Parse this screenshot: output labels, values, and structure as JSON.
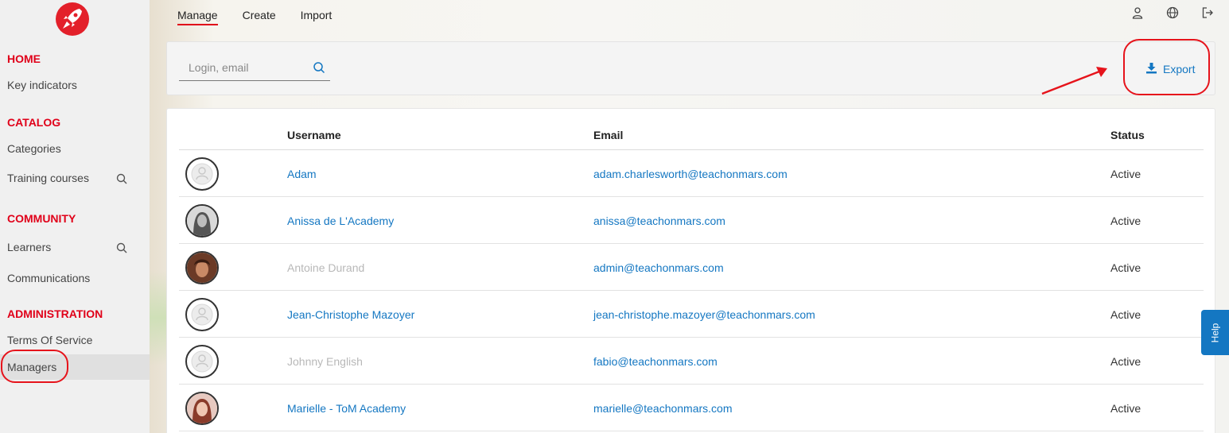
{
  "sidebar": {
    "sections": [
      {
        "title": "HOME",
        "items": [
          {
            "label": "Key indicators"
          }
        ]
      },
      {
        "title": "CATALOG",
        "items": [
          {
            "label": "Categories"
          },
          {
            "label": "Training courses"
          }
        ]
      },
      {
        "title": "COMMUNITY",
        "items": [
          {
            "label": "Learners"
          },
          {
            "label": "Communications"
          }
        ]
      },
      {
        "title": "ADMINISTRATION",
        "items": [
          {
            "label": "Terms Of Service"
          },
          {
            "label": "Managers"
          }
        ]
      }
    ]
  },
  "topnav": {
    "tabs": [
      "Manage",
      "Create",
      "Import"
    ],
    "active": "Manage"
  },
  "toolbar": {
    "search_placeholder": "Login, email",
    "export_label": "Export"
  },
  "table": {
    "columns": {
      "username": "Username",
      "email": "Email",
      "status": "Status"
    },
    "rows": [
      {
        "username": "Adam",
        "email": "adam.charlesworth@teachonmars.com",
        "status": "Active",
        "avatar": "default-avatar-icon",
        "dimmed": false
      },
      {
        "username": "Anissa de L'Academy",
        "email": "anissa@teachonmars.com",
        "status": "Active",
        "avatar": "photo",
        "dimmed": false
      },
      {
        "username": "Antoine Durand",
        "email": "admin@teachonmars.com",
        "status": "Active",
        "avatar": "photo",
        "dimmed": true
      },
      {
        "username": "Jean-Christophe Mazoyer",
        "email": "jean-christophe.mazoyer@teachonmars.com",
        "status": "Active",
        "avatar": "default-avatar-icon",
        "dimmed": false
      },
      {
        "username": "Johnny English",
        "email": "fabio@teachonmars.com",
        "status": "Active",
        "avatar": "default-avatar-icon",
        "dimmed": true
      },
      {
        "username": "Marielle - ToM Academy",
        "email": "marielle@teachonmars.com",
        "status": "Active",
        "avatar": "photo",
        "dimmed": false
      }
    ]
  },
  "help": {
    "label": "Help"
  },
  "colors": {
    "accent_red": "#e00019",
    "link_blue": "#1477c2",
    "annotation_red": "#e6131b"
  }
}
